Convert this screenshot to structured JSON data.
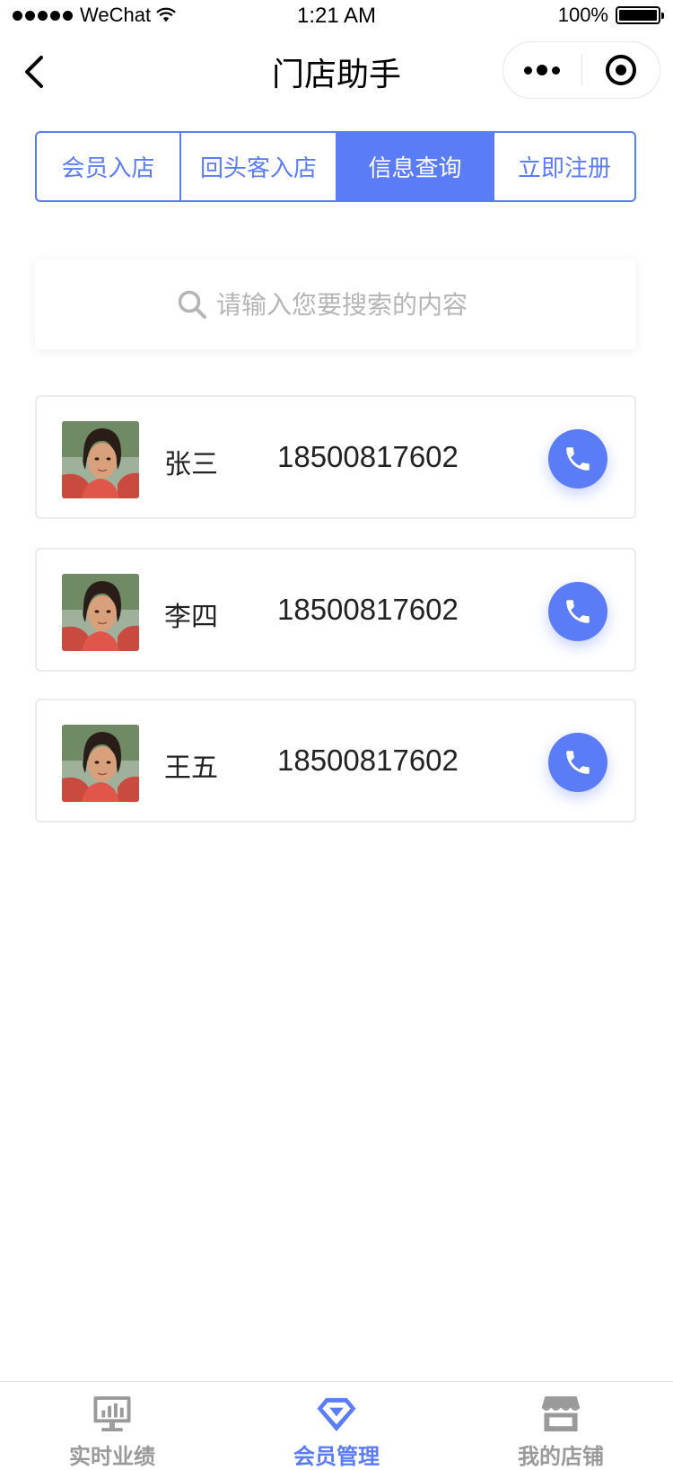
{
  "status_bar": {
    "carrier": "WeChat",
    "time": "1:21 AM",
    "battery": "100%",
    "battery_level": 1.0
  },
  "nav": {
    "title": "门店助手"
  },
  "tabs": [
    {
      "label": "会员入店",
      "active": false
    },
    {
      "label": "回头客入店",
      "active": false
    },
    {
      "label": "信息查询",
      "active": true
    },
    {
      "label": "立即注册",
      "active": false
    }
  ],
  "search": {
    "placeholder": "请输入您要搜索的内容",
    "value": ""
  },
  "members": [
    {
      "name": "张三",
      "phone": "18500817602"
    },
    {
      "name": "李四",
      "phone": "18500817602"
    },
    {
      "name": "王五",
      "phone": "18500817602"
    }
  ],
  "tabbar": [
    {
      "label": "实时业绩",
      "icon": "chart-monitor-icon",
      "active": false
    },
    {
      "label": "会员管理",
      "icon": "diamond-icon",
      "active": true
    },
    {
      "label": "我的店铺",
      "icon": "store-icon",
      "active": false
    }
  ],
  "colors": {
    "accent": "#5b7cf7",
    "inactive": "#9a9a9a"
  }
}
